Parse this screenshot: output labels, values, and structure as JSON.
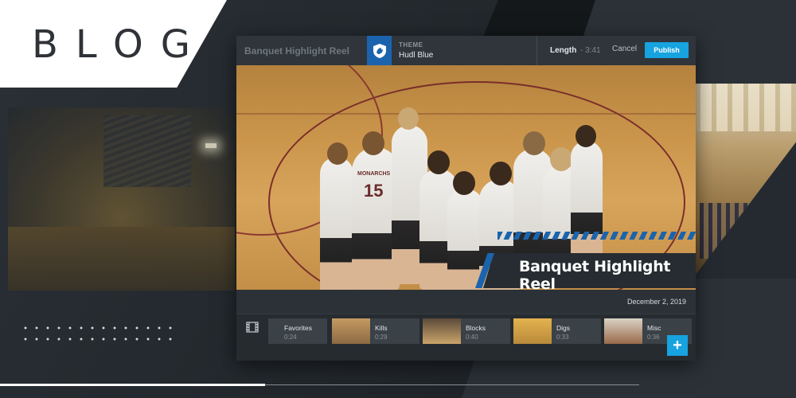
{
  "blog_label": "BLOG",
  "editor": {
    "project_title": "Banquet Highlight Reel",
    "theme": {
      "label": "THEME",
      "name": "Hudl Blue"
    },
    "length": {
      "label": "Length",
      "value": "- 3:41"
    },
    "cancel_label": "Cancel",
    "publish_label": "Publish",
    "video": {
      "caption": "Banquet Highlight Reel",
      "jersey_number": "15",
      "jersey_name": "MONARCHS"
    },
    "date": "December 2, 2019",
    "clips": [
      {
        "name": "Favorites",
        "duration": "0:24"
      },
      {
        "name": "Kills",
        "duration": "0:29"
      },
      {
        "name": "Blocks",
        "duration": "0:40"
      },
      {
        "name": "Digs",
        "duration": "0:33"
      },
      {
        "name": "Misc",
        "duration": "0:36"
      }
    ],
    "add_label": "+"
  },
  "colors": {
    "accent": "#16a3e0",
    "theme_blue": "#1b64ad",
    "panel": "#2c3238",
    "background": "#1c2126"
  },
  "icons": {
    "film": "film-icon",
    "theme_logo": "shield-logo-icon",
    "add": "plus-icon"
  }
}
